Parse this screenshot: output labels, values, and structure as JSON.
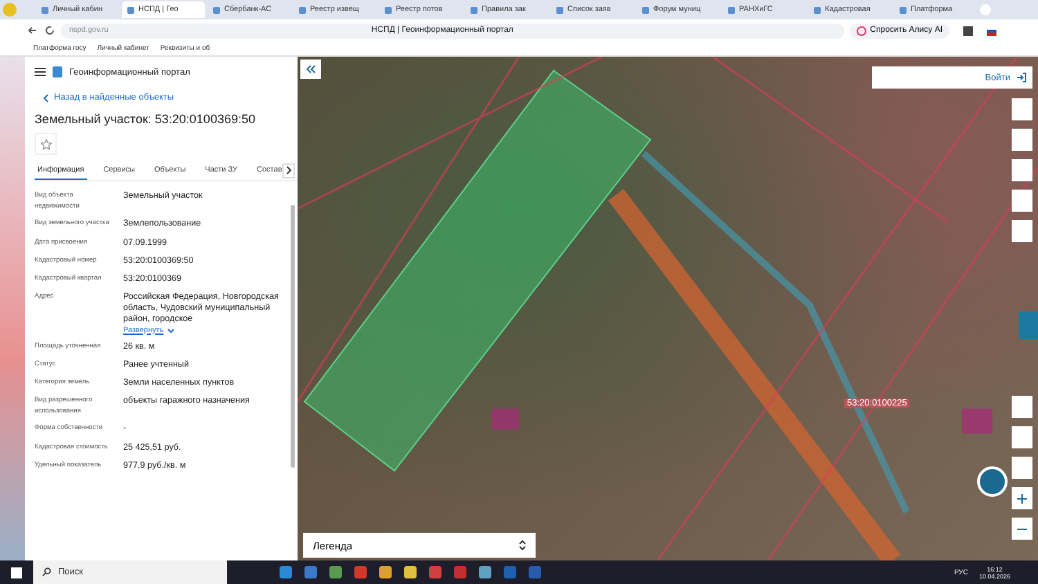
{
  "browser": {
    "tabs": [
      {
        "label": "Личный кабин",
        "selected": false
      },
      {
        "label": "НСПД | Гео",
        "selected": true
      },
      {
        "label": "Сбербанк-АС",
        "selected": false
      },
      {
        "label": "Реестр извещ",
        "selected": false
      },
      {
        "label": "Реестр потов",
        "selected": false
      },
      {
        "label": "Правила зак",
        "selected": false
      },
      {
        "label": "Список заяв",
        "selected": false
      },
      {
        "label": "Форум муниц",
        "selected": false
      },
      {
        "label": "РАНХиГС",
        "selected": false
      },
      {
        "label": "Кадастровая",
        "selected": false
      },
      {
        "label": "Платформа",
        "selected": false
      }
    ],
    "address": "nspd.gov.ru",
    "page_title": "НСПД | Геоинформационный портал",
    "alice_button": "Спросить Алису AI",
    "bookmarks": [
      "Платформа госу",
      "Личный кабинет",
      "Реквизиты и об"
    ]
  },
  "panel": {
    "portal_title": "Геоинформационный портал",
    "back_link": "Назад в найденные объекты",
    "heading": "Земельный участок: 53:20:0100369:50",
    "tabs": [
      {
        "label": "Информация",
        "selected": true
      },
      {
        "label": "Сервисы",
        "selected": false
      },
      {
        "label": "Объекты",
        "selected": false
      },
      {
        "label": "Части ЗУ",
        "selected": false
      },
      {
        "label": "Состав",
        "selected": false
      }
    ],
    "fields": [
      {
        "label": "Вид объекта недвижимости",
        "value": "Земельный участок"
      },
      {
        "label": "Вид земельного участка",
        "value": "Землепользование"
      },
      {
        "label": "Дата присвоения",
        "value": "07.09.1999"
      },
      {
        "label": "Кадастровый номер",
        "value": "53:20:0100369:50"
      },
      {
        "label": "Кадастровый квартал",
        "value": "53:20:0100369"
      },
      {
        "label": "Адрес",
        "value": "Российская Федерация, Новгородская область, Чудовский муниципальный район, городское",
        "expand_link": "Развернуть"
      },
      {
        "label": "Площадь уточненная",
        "value": "26 кв. м"
      },
      {
        "label": "Статус",
        "value": "Ранее учтенный"
      },
      {
        "label": "Категория земель",
        "value": "Земли населенных пунктов"
      },
      {
        "label": "Вид разрешенного использования",
        "value": "объекты гаражного назначения"
      },
      {
        "label": "Форма собственности",
        "value": "-"
      },
      {
        "label": "Кадастровая стоимость",
        "value": "25 425,51 руб."
      },
      {
        "label": "Удельный показатель",
        "value": "977,9 руб./кв. м"
      }
    ]
  },
  "map": {
    "login_button": "Войти",
    "legend": "Легенда",
    "parcel_label": "53:20:0100225"
  },
  "taskbar": {
    "search": "Поиск",
    "language": "РУС",
    "time": "16:12",
    "date": "10.04.2026"
  }
}
